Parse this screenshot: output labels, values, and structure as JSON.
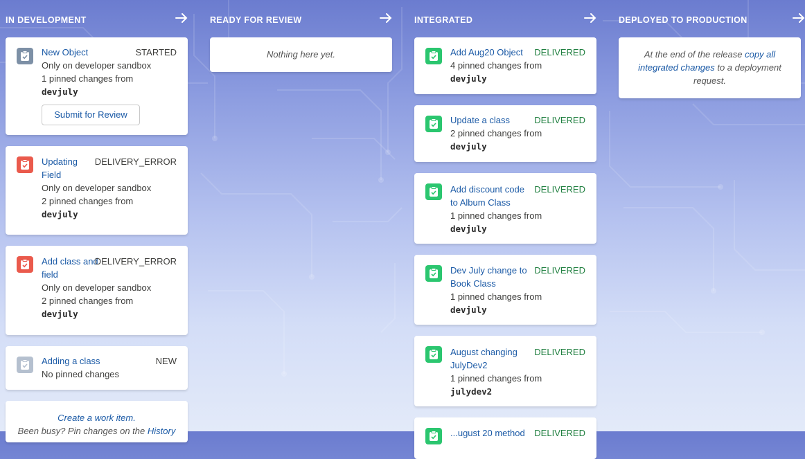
{
  "columns": [
    {
      "title": "IN DEVELOPMENT",
      "items": [
        {
          "title": "New Object",
          "status": "STARTED",
          "line1": "Only on developer sandbox",
          "line2": "1 pinned changes from",
          "sandbox": "devjuly",
          "button": "Submit for Review"
        },
        {
          "title_a": "Updating",
          "title_b": "Field",
          "status": "DELIVERY_ERROR",
          "line1": "Only on developer sandbox",
          "line2": "2 pinned changes from",
          "sandbox": "devjuly"
        },
        {
          "title_a": "Add class and",
          "title_b": "field",
          "status": "DELIVERY_ERROR",
          "line1": "Only on developer sandbox",
          "line2": "2 pinned changes from",
          "sandbox": "devjuly"
        },
        {
          "title": "Adding a class",
          "status": "NEW",
          "line1": "No pinned changes"
        }
      ],
      "footer": {
        "create_link": "Create a work item.",
        "pin_prefix": "Been busy? Pin changes on the",
        "history_link": "History"
      }
    },
    {
      "title": "READY FOR REVIEW",
      "empty": "Nothing here yet."
    },
    {
      "title": "INTEGRATED",
      "items": [
        {
          "title": "Add Aug20 Object",
          "status": "DELIVERED",
          "line1": "4 pinned changes from",
          "sandbox": "devjuly"
        },
        {
          "title": "Update a class",
          "status": "DELIVERED",
          "line1": "2 pinned changes from",
          "sandbox": "devjuly"
        },
        {
          "title_a": "Add discount code",
          "title_b": "to Album Class",
          "status": "DELIVERED",
          "line1": "1 pinned changes from",
          "sandbox": "devjuly"
        },
        {
          "title_a": "Dev July change to",
          "title_b": "Book Class",
          "status": "DELIVERED",
          "line1": "1 pinned changes from",
          "sandbox": "devjuly"
        },
        {
          "title_a": "August changing",
          "title_b": "JulyDev2",
          "status": "DELIVERED",
          "line1": "1 pinned changes from",
          "sandbox": "julydev2"
        },
        {
          "title": "...ugust 20 method",
          "status": "DELIVERED"
        }
      ]
    },
    {
      "title": "DEPLOYED TO PRODUCTION",
      "empty_a": "At the end of the release",
      "empty_link_a": "copy all",
      "empty_link_b": "integrated changes",
      "empty_b": "to a deployment",
      "empty_c": "request."
    }
  ],
  "icons": {
    "arrow": "arrow-right-icon",
    "work_item": "clipboard-check-icon"
  },
  "colors": {
    "link": "#1b5aa6",
    "delivered": "#1f7f3f",
    "error_icon": "#ea5a4c",
    "delivered_icon": "#2bc66f",
    "started_icon": "#7d90a6",
    "new_icon": "#b5c0cf"
  }
}
